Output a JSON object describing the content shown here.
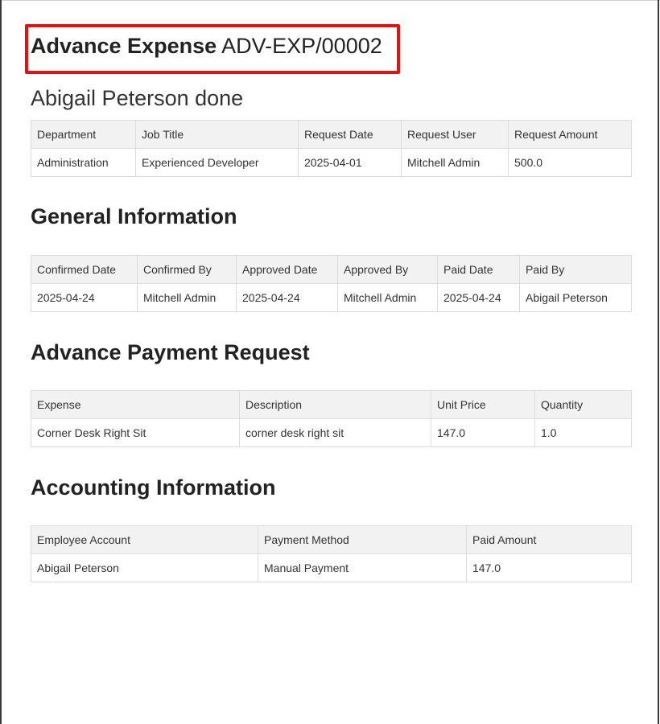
{
  "document": {
    "title_label": "Advance Expense",
    "reference": "ADV-EXP/00002",
    "employee_line": "Abigail Peterson done"
  },
  "request_table": {
    "headers": [
      "Department",
      "Job Title",
      "Request Date",
      "Request User",
      "Request Amount"
    ],
    "row": [
      "Administration",
      "Experienced Developer",
      "2025-04-01",
      "Mitchell Admin",
      "500.0"
    ]
  },
  "general": {
    "heading": "General Information",
    "headers": [
      "Confirmed Date",
      "Confirmed By",
      "Approved Date",
      "Approved By",
      "Paid Date",
      "Paid By"
    ],
    "row": [
      "2025-04-24",
      "Mitchell Admin",
      "2025-04-24",
      "Mitchell Admin",
      "2025-04-24",
      "Abigail Peterson"
    ]
  },
  "payment_request": {
    "heading": "Advance Payment Request",
    "headers": [
      "Expense",
      "Description",
      "Unit Price",
      "Quantity"
    ],
    "row": [
      "Corner Desk Right Sit",
      "corner desk right sit",
      "147.0",
      "1.0"
    ]
  },
  "accounting": {
    "heading": "Accounting Information",
    "headers": [
      "Employee Account",
      "Payment Method",
      "Paid Amount"
    ],
    "row": [
      "Abigail Peterson",
      "Manual Payment",
      "147.0"
    ]
  },
  "colors": {
    "highlight_border": "#e31212",
    "header_bg": "#f2f2f2",
    "cell_border": "#dcdcdc"
  }
}
